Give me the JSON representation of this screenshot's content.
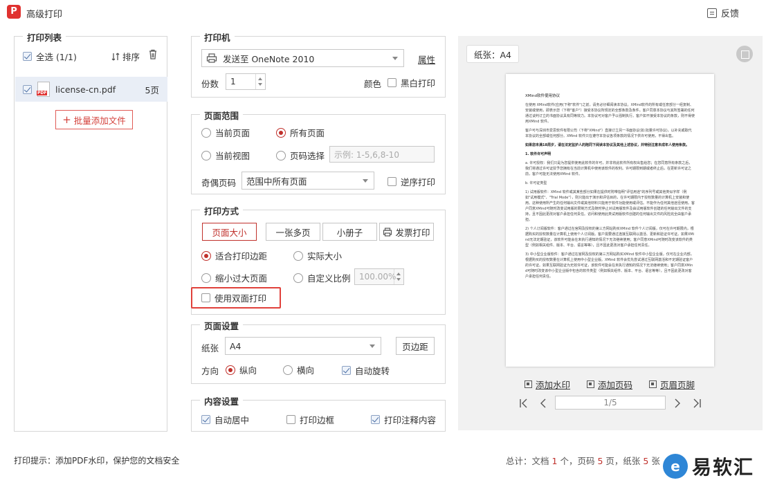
{
  "window": {
    "title": "高级打印",
    "app_logo": "P",
    "feedback": "反馈"
  },
  "print_list": {
    "legend": "打印列表",
    "select_all": "全选 (1/1)",
    "sort": "排序",
    "files": [
      {
        "name": "license-cn.pdf",
        "pages": "5页"
      }
    ],
    "add_files": "批量添加文件"
  },
  "printer": {
    "legend": "打印机",
    "selected": "发送至 OneNote 2010",
    "properties": "属性",
    "copies_label": "份数",
    "copies": "1",
    "color_label": "颜色",
    "bw_print": "黑白打印"
  },
  "page_range": {
    "legend": "页面范围",
    "current_page": "当前页面",
    "all_pages": "所有页面",
    "current_view": "当前视图",
    "page_select": "页码选择",
    "page_select_placeholder": "示例: 1-5,6,8-10",
    "odd_even_label": "奇偶页码",
    "odd_even_value": "范围中所有页面",
    "reverse": "逆序打印"
  },
  "print_mode": {
    "legend": "打印方式",
    "modes": [
      "页面大小",
      "一张多页",
      "小册子",
      "发票打印"
    ],
    "fit_margin": "适合打印边距",
    "actual_size": "实际大小",
    "shrink_large": "缩小过大页面",
    "custom_scale": "自定义比例",
    "scale_value": "100.00%",
    "duplex": "使用双面打印"
  },
  "page_setup": {
    "legend": "页面设置",
    "paper_label": "纸张",
    "paper_value": "A4",
    "margin_btn": "页边距",
    "orientation_label": "方向",
    "portrait": "纵向",
    "landscape": "横向",
    "auto_rotate": "自动旋转"
  },
  "content_setup": {
    "legend": "内容设置",
    "auto_center": "自动居中",
    "print_border": "打印边框",
    "print_annotations": "打印注释内容"
  },
  "preview": {
    "paper_tag": "纸张：A4",
    "doc": {
      "title": "XMind软件使用协议",
      "paragraphs": [
        "在使用 XMind软件(应用(下称\"软件\")之前，请务必仔细阅读本协议。XMind软件的所有或任意部分一经复制、安装或使用，即表示您（下称\"客户\"）接受本协议所规定的全部条款及条件。客户同意本协议与其所签署的任何通过谈判订立的书面协议具有同等效力。本协议可对客户予以强制执行。客户如不接受本协议的条款，则不得使用XMind 软件。",
        "客户可与深圳市爱思软件有限公司（下称\"XMind\"）直接订立另一书面协议(如:批量许可协议)，以补充或取代本协议的全部或任何部分。XMind 软件只在遵守本协议各项条款的情况下供许可使用，不得出售。",
        "如果您未满18周岁，请在法定监护人的陪同下阅读本协议及其他上述协议，并特别注意未成年人使用条款。",
        "1. 软件许可声明",
        "a. 许可授权：我们只是为您提供使用此软件的许可，并非将此软件所有权出售给您；在您同意所有条款之后，我们将通过许可证授予您拥有在当前计算机中使用该软件的权利。许可期限到期或者终止后，在更新许可证之前，客户可能无法使用XMind 软件。",
        "b. 许可证类型",
        "1) 试用版软件：XMind 软件或其某些部分如果在提供时附带指明\"评估用途\"的序列号或其他类似字样（例如\"试用模式\"、\"Trial Mode\"），则只能出于演示和评估目的，在许可期限内于授权数量的计算机上安装和使用。这种使用所产生的任何输出文件或其他材料只能用于软件功能使用或评估。不能作为任何其他途径使用。客户同意XMind可随时改变试用版的限制方式及随时停止对试用版软件及由试用版软件创建的任何输出文件的支持，且不因此更改对客户承担任何责任。访问和使用此类试用版软件创建的任何输出文件的风险完全由客户承担。",
        "2) 个人订阅版软件：客户通过在官网及授权的第三方网站购买XMind 软件个人订阅版，仅可在许可期限内，根据购买的授权数量在计算机上使用个人订阅版。客户需要通过连接互联网以激活、更新和验证许可证。如果XMind无法定期验证，该软件可能会在未执行通知的情况下无法继续使用；客户同意XMind可随时改变该软件的类型（例如相关组件、版本、平台、语言等等），且不因此更改对客户承担任何责任。",
        "3) 中小型企业版软件：客户通过在官网及授权的第三方网站购买XMind 软件中小型企业版，仅可在企业内部，根据购买的授权数量在计算机上使用中小型企业版。XMind 软件会优先尝试通过互联网激活和不定期验证客户的许可证。如果互联网验证为无效许可证，该软件可能会在未执行通知的情况下无法继续使用；客户同意XMind可随时改变该中小型企业版中包含的软件类型（例如相关组件、版本、平台、语言等等），且不因此更改对客户承担任何责任。"
      ]
    },
    "add_watermark": "添加水印",
    "add_page_number": "添加页码",
    "header_footer": "页眉页脚",
    "page_indicator": "1/5"
  },
  "footer": {
    "hint": "打印提示：添加PDF水印，保护您的文档安全",
    "summary_prefix": "总计：文档",
    "doc_count": "1",
    "unit_docs": "个，页码",
    "page_count": "5",
    "unit_pages": "页，纸张",
    "sheet_count": "5",
    "unit_sheets": "张"
  },
  "watermark": {
    "logo": "e",
    "text": "易软汇"
  },
  "colors": {
    "accent": "#c0302b",
    "selection_bg": "#e9eef6",
    "preview_bg": "#f1f1f1"
  }
}
